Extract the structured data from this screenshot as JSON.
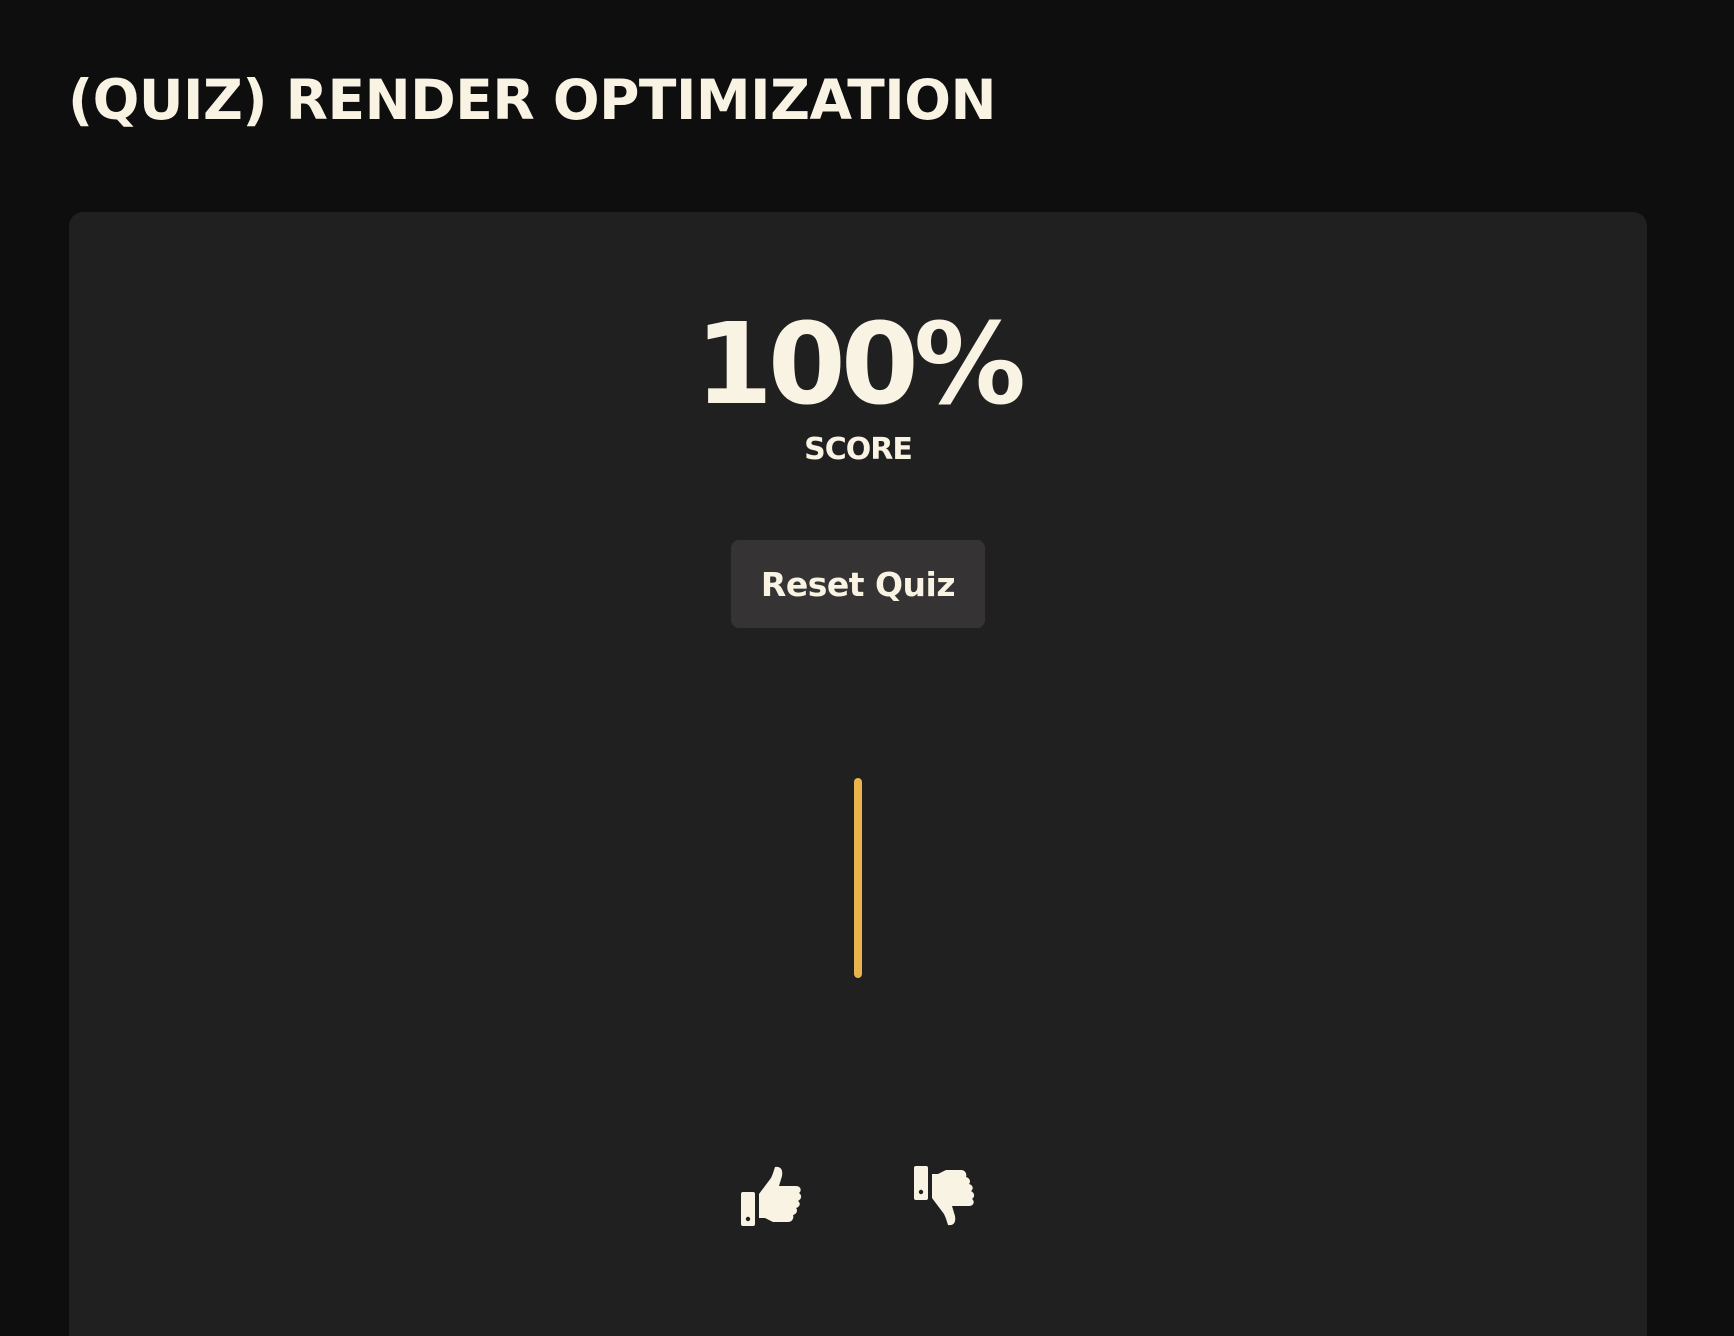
{
  "page": {
    "title": "(QUIZ) RENDER OPTIMIZATION"
  },
  "quiz": {
    "score_value": "100%",
    "score_label": "SCORE",
    "reset_label": "Reset Quiz"
  },
  "feedback": {
    "thumbs_up_icon": "thumbs-up-icon",
    "thumbs_down_icon": "thumbs-down-icon"
  },
  "colors": {
    "background": "#0f0e0f",
    "card": "#212021",
    "button": "#353333",
    "text": "#f8f3e3",
    "accent": "#e9b44c"
  }
}
